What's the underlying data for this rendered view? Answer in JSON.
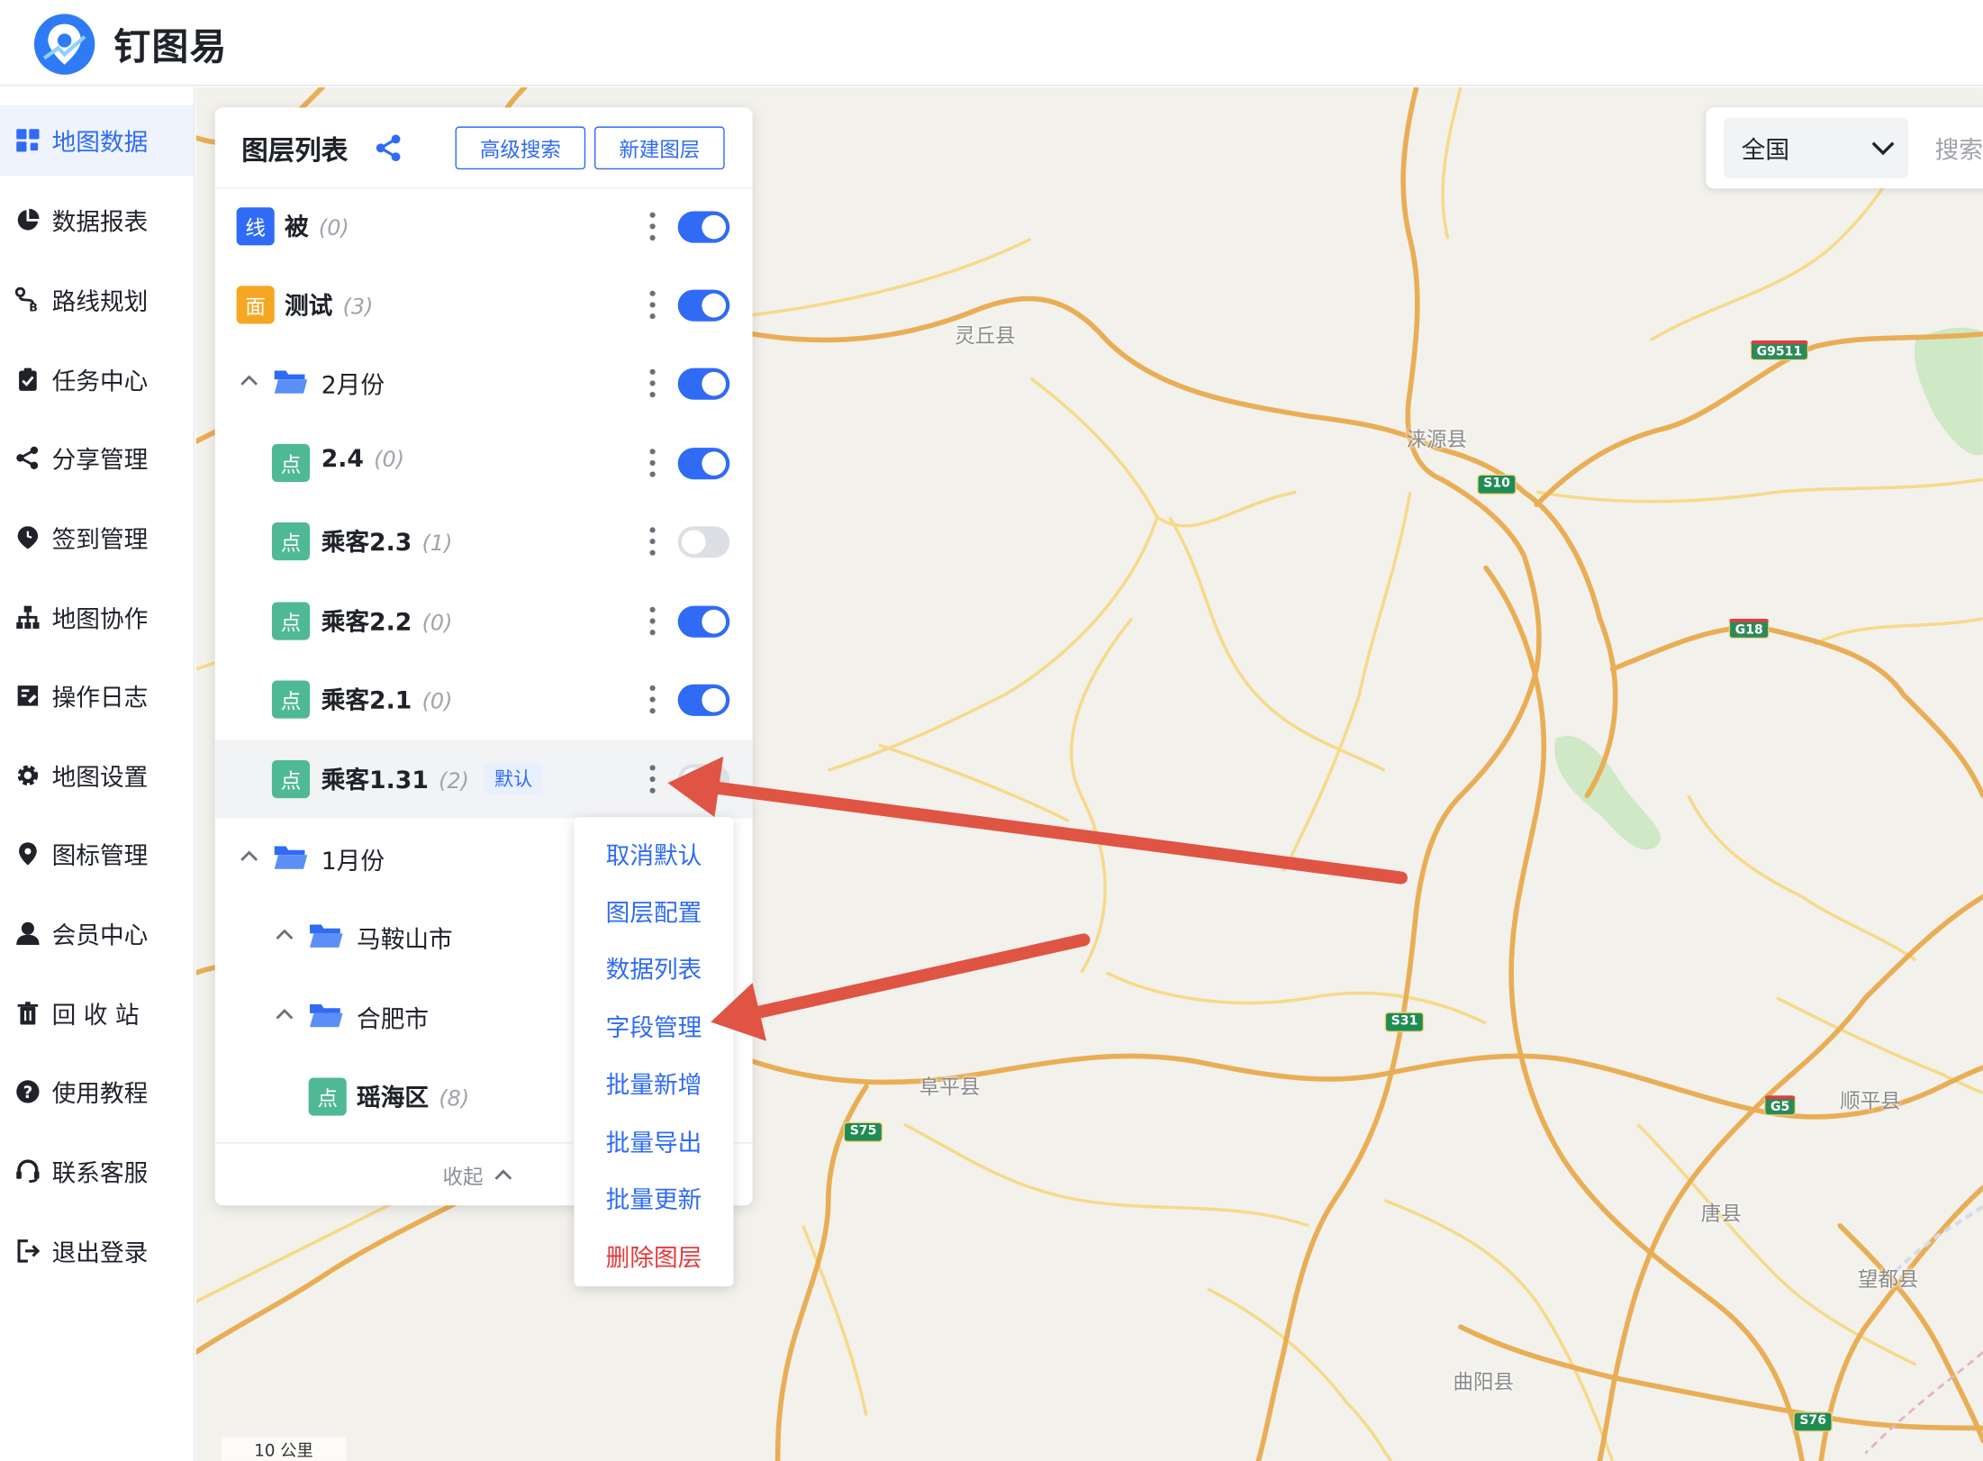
{
  "app": {
    "title": "钉图易"
  },
  "sidebar": {
    "items": [
      {
        "label": "地图数据",
        "icon": "dashboard-icon",
        "active": true
      },
      {
        "label": "数据报表",
        "icon": "pie-chart-icon"
      },
      {
        "label": "路线规划",
        "icon": "route-icon"
      },
      {
        "label": "任务中心",
        "icon": "clipboard-icon"
      },
      {
        "label": "分享管理",
        "icon": "share-icon"
      },
      {
        "label": "签到管理",
        "icon": "location-clock-icon"
      },
      {
        "label": "地图协作",
        "icon": "org-chart-icon"
      },
      {
        "label": "操作日志",
        "icon": "log-icon"
      },
      {
        "label": "地图设置",
        "icon": "gear-icon"
      },
      {
        "label": "图标管理",
        "icon": "map-pin-icon"
      },
      {
        "label": "会员中心",
        "icon": "user-icon"
      },
      {
        "label": "回 收 站",
        "icon": "trash-icon"
      },
      {
        "label": "使用教程",
        "icon": "help-icon"
      },
      {
        "label": "联系客服",
        "icon": "headset-icon"
      },
      {
        "label": "退出登录",
        "icon": "logout-icon"
      }
    ]
  },
  "search": {
    "region": "全国",
    "placeholder": "搜索"
  },
  "layer_panel": {
    "title": "图层列表",
    "buttons": {
      "advanced_search": "高级搜索",
      "new_layer": "新建图层"
    },
    "rows": [
      {
        "type": "layer",
        "badge": "线",
        "badge_kind": "line",
        "name": "被",
        "count": "(0)",
        "visible": true
      },
      {
        "type": "layer",
        "badge": "面",
        "badge_kind": "area",
        "name": "测试",
        "count": "(3)",
        "visible": true
      },
      {
        "type": "folder",
        "name": "2月份",
        "visible": true
      },
      {
        "type": "layer",
        "badge": "点",
        "badge_kind": "point",
        "name": "2.4",
        "count": "(0)",
        "visible": true
      },
      {
        "type": "layer",
        "badge": "点",
        "badge_kind": "point",
        "name": "乘客2.3",
        "count": "(1)",
        "visible": false
      },
      {
        "type": "layer",
        "badge": "点",
        "badge_kind": "point",
        "name": "乘客2.2",
        "count": "(0)",
        "visible": true
      },
      {
        "type": "layer",
        "badge": "点",
        "badge_kind": "point",
        "name": "乘客2.1",
        "count": "(0)",
        "visible": true
      },
      {
        "type": "layer",
        "badge": "点",
        "badge_kind": "point",
        "name": "乘客1.31",
        "count": "(2)",
        "tag": "默认",
        "visible": false
      },
      {
        "type": "folder",
        "name": "1月份"
      },
      {
        "type": "folder",
        "name": "马鞍山市"
      },
      {
        "type": "folder",
        "name": "合肥市"
      },
      {
        "type": "layer",
        "badge": "点",
        "badge_kind": "point",
        "name": "瑶海区",
        "count": "(8)"
      }
    ],
    "footer": {
      "collapse": "收起"
    }
  },
  "context_menu": {
    "items": [
      {
        "label": "取消默认"
      },
      {
        "label": "图层配置"
      },
      {
        "label": "数据列表"
      },
      {
        "label": "字段管理"
      },
      {
        "label": "批量新增"
      },
      {
        "label": "批量导出"
      },
      {
        "label": "批量更新"
      },
      {
        "label": "删除图层",
        "danger": true
      }
    ]
  },
  "map": {
    "places": [
      "灵丘县",
      "涞源县",
      "阜平县",
      "顺平县",
      "唐县",
      "望都县",
      "曲阳县"
    ],
    "shields": [
      "G9511",
      "S10",
      "G18",
      "S31",
      "S75",
      "G5",
      "S76"
    ],
    "scale": "10 公里"
  },
  "colors": {
    "accent": "#2f6bf5",
    "danger": "#e5393b",
    "point_badge": "#4fb995",
    "area_badge": "#f5a623",
    "arrow": "#e05444"
  }
}
